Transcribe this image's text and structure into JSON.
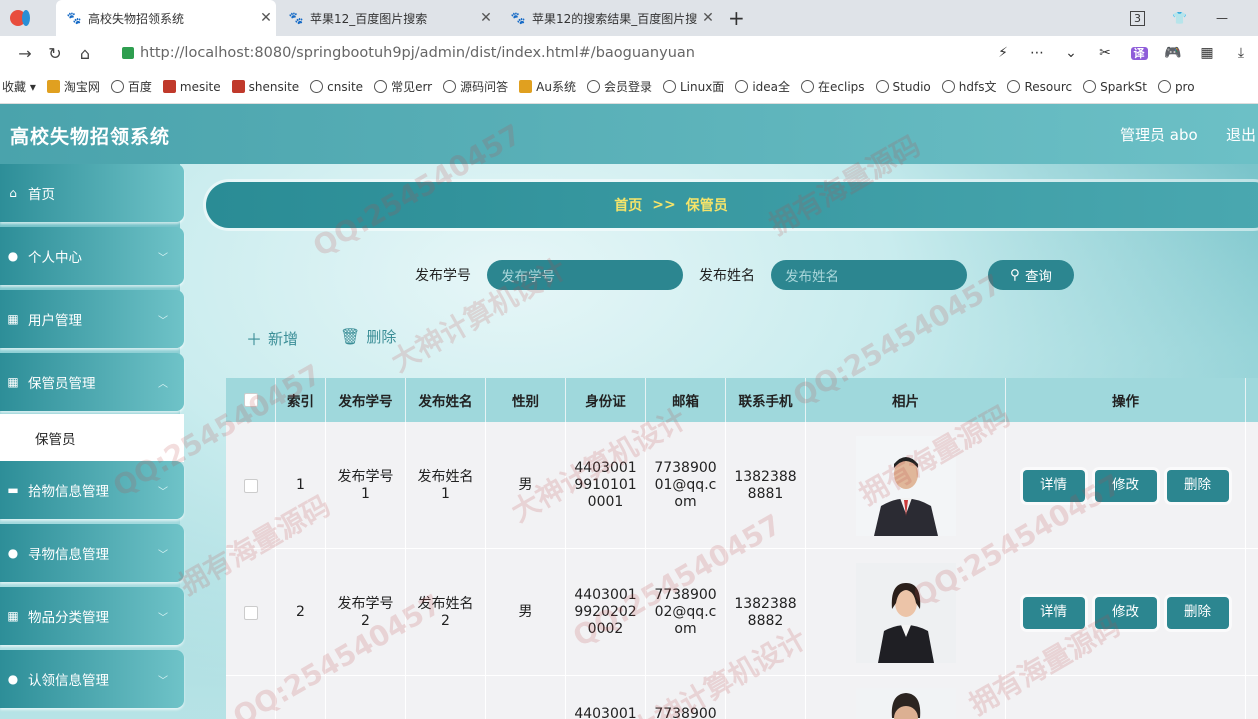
{
  "browser": {
    "tabs": [
      {
        "title": "高校失物招领系统"
      },
      {
        "title": "苹果12_百度图片搜索"
      },
      {
        "title": "苹果12的搜索结果_百度图片搜"
      }
    ],
    "tab_count_badge": "3",
    "url": "http://localhost:8080/springbootuh9pj/admin/dist/index.html#/baoguanyuan",
    "bookmarks": [
      "收藏",
      "淘宝网",
      "百度",
      "mesite",
      "shensite",
      "cnsite",
      "常见err",
      "源码问答",
      "Au系统",
      "会员登录",
      "Linux面",
      "idea全",
      "在eclips",
      "Studio",
      "hdfs文",
      "Resourc",
      "SparkSt",
      "pro"
    ]
  },
  "app": {
    "title": "高校失物招领系统",
    "user_label": "管理员 abo",
    "logout_label": "退出"
  },
  "sidebar": {
    "items": [
      {
        "label": "首页",
        "icon": "home-icon",
        "chevron": false
      },
      {
        "label": "个人中心",
        "icon": "user-icon",
        "chevron": true
      },
      {
        "label": "用户管理",
        "icon": "grid-icon",
        "chevron": true
      },
      {
        "label": "保管员管理",
        "icon": "grid-icon",
        "chevron": true
      },
      {
        "label": "拾物信息管理",
        "icon": "monitor-icon",
        "chevron": true
      },
      {
        "label": "寻物信息管理",
        "icon": "user-icon",
        "chevron": true
      },
      {
        "label": "物品分类管理",
        "icon": "grid-icon",
        "chevron": true
      },
      {
        "label": "认领信息管理",
        "icon": "user-icon",
        "chevron": true
      }
    ],
    "subitem": "保管员"
  },
  "breadcrumb": {
    "home": "首页",
    "separator": ">>",
    "current": "保管员"
  },
  "search": {
    "field1_label": "发布学号",
    "field1_placeholder": "发布学号",
    "field2_label": "发布姓名",
    "field2_placeholder": "发布姓名",
    "query_label": "查询"
  },
  "toolbar": {
    "add_label": "新增",
    "delete_label": "删除"
  },
  "table": {
    "headers": [
      "索引",
      "发布学号",
      "发布姓名",
      "性别",
      "身份证",
      "邮箱",
      "联系手机",
      "相片",
      "操作"
    ],
    "rows": [
      {
        "index": "1",
        "xuehao": "发布学号\n1",
        "name": "发布姓名\n1",
        "gender": "男",
        "id_card": "4403001\n9910101\n0001",
        "email": "7738900\n01@qq.c\nom",
        "phone": "1382388\n8881",
        "photo": "man-in-suit-photo"
      },
      {
        "index": "2",
        "xuehao": "发布学号\n2",
        "name": "发布姓名\n2",
        "gender": "男",
        "id_card": "4403001\n9920202\n0002",
        "email": "7738900\n02@qq.c\nom",
        "phone": "1382388\n8882",
        "photo": "woman-in-suit-photo"
      },
      {
        "index": "",
        "xuehao": "",
        "name": "",
        "gender": "",
        "id_card": "4403001",
        "email": "7738900",
        "phone": "",
        "photo": "man-photo-partial"
      }
    ],
    "op_detail": "详情",
    "op_edit": "修改",
    "op_delete": "删除"
  },
  "watermark": [
    "QQ:254540457",
    "大神计算机设计",
    "拥有海量源码"
  ]
}
